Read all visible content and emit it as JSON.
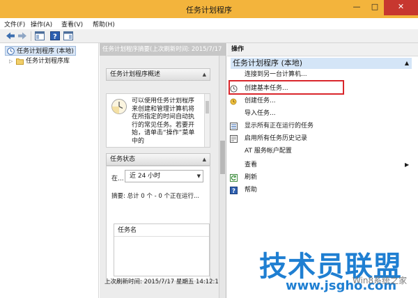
{
  "window": {
    "title": "任务计划程序",
    "min_glyph": "—",
    "max_glyph": "□",
    "close_glyph": "✕"
  },
  "menu": [
    "文件(F)",
    "操作(A)",
    "查看(V)",
    "帮助(H)"
  ],
  "toolbar_icons": [
    "back-arrow-icon",
    "forward-arrow-icon",
    "show-hide-tree-icon",
    "help-icon",
    "show-hide-action-pane-icon"
  ],
  "tree": {
    "root": "任务计划程序 (本地)",
    "child": "任务计划程序库"
  },
  "middle": {
    "header": "任务计划程序摘要(上次刷新时间: 2015/7/17",
    "overview": {
      "title": "任务计划程序概述",
      "text": "可以使用任务计划程序来创建和管理计算机将在所指定的时间自动执行的常见任务。若要开始，请单击“操作”菜单中的"
    },
    "status": {
      "title": "任务状态",
      "in_label": "在...",
      "range": "近 24 小时",
      "summary": "摘要: 总计 0 个 - 0 个正在运行...",
      "table_header": "任务名"
    },
    "last_refresh": "上次刷新时间: 2015/7/17 星期五 14:12:1"
  },
  "actions": {
    "header": "操作",
    "group": "任务计划程序 (本地)",
    "items": [
      "连接到另一台计算机...",
      "创建基本任务...",
      "创建任务...",
      "导入任务...",
      "显示所有正在运行的任务",
      "启用所有任务历史记录",
      "AT 服务帐户配置",
      "查看",
      "刷新",
      "帮助"
    ]
  },
  "watermark": {
    "brand": "技术员联盟",
    "url": "www.jsgho.com",
    "sub": "Win8系统之家"
  },
  "colors": {
    "title_bar": "#f3b43c",
    "close_button": "#c7372f",
    "selection": "#d4e5f7",
    "highlight_box": "#d9262b",
    "watermark": "#1f7fd2"
  }
}
